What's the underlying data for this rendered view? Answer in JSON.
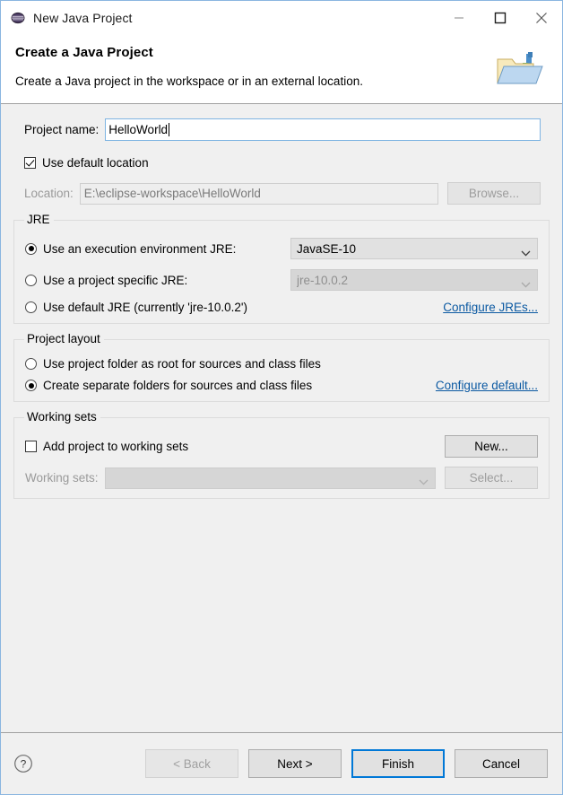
{
  "window": {
    "title": "New Java Project",
    "icon": "eclipse-sphere-icon",
    "controls": {
      "minimize": "minimize-icon",
      "maximize": "maximize-icon",
      "close": "close-icon"
    }
  },
  "header": {
    "title": "Create a Java Project",
    "description": "Create a Java project in the workspace or in an external location.",
    "icon": "open-folder-icon"
  },
  "project": {
    "name_label": "Project name:",
    "name_value": "HelloWorld",
    "use_default_location_label": "Use default location",
    "use_default_location_checked": true,
    "location_label": "Location:",
    "location_value": "E:\\eclipse-workspace\\HelloWorld",
    "browse_label": "Browse...",
    "browse_enabled": false
  },
  "jre": {
    "group_label": "JRE",
    "options": [
      {
        "label": "Use an execution environment JRE:",
        "selected": true,
        "combo_value": "JavaSE-10",
        "combo_enabled": true
      },
      {
        "label": "Use a project specific JRE:",
        "selected": false,
        "combo_value": "jre-10.0.2",
        "combo_enabled": false
      },
      {
        "label": "Use default JRE (currently 'jre-10.0.2')",
        "selected": false
      }
    ],
    "configure_link": "Configure JREs..."
  },
  "project_layout": {
    "group_label": "Project layout",
    "options": [
      {
        "label": "Use project folder as root for sources and class files",
        "selected": false
      },
      {
        "label": "Create separate folders for sources and class files",
        "selected": true
      }
    ],
    "configure_link": "Configure default..."
  },
  "working_sets": {
    "group_label": "Working sets",
    "add_label": "Add project to working sets",
    "add_checked": false,
    "new_label": "New...",
    "new_enabled": true,
    "sets_label": "Working sets:",
    "sets_value": "",
    "select_label": "Select...",
    "select_enabled": false
  },
  "buttons": {
    "help": "help-icon",
    "back": "< Back",
    "back_enabled": false,
    "next": "Next >",
    "finish": "Finish",
    "cancel": "Cancel",
    "default_button": "Finish"
  },
  "colors": {
    "accent": "#0078d7",
    "link": "#0b59a2",
    "dialog_bg": "#f0f0f0",
    "field_focus_border": "#7eb4e2"
  }
}
